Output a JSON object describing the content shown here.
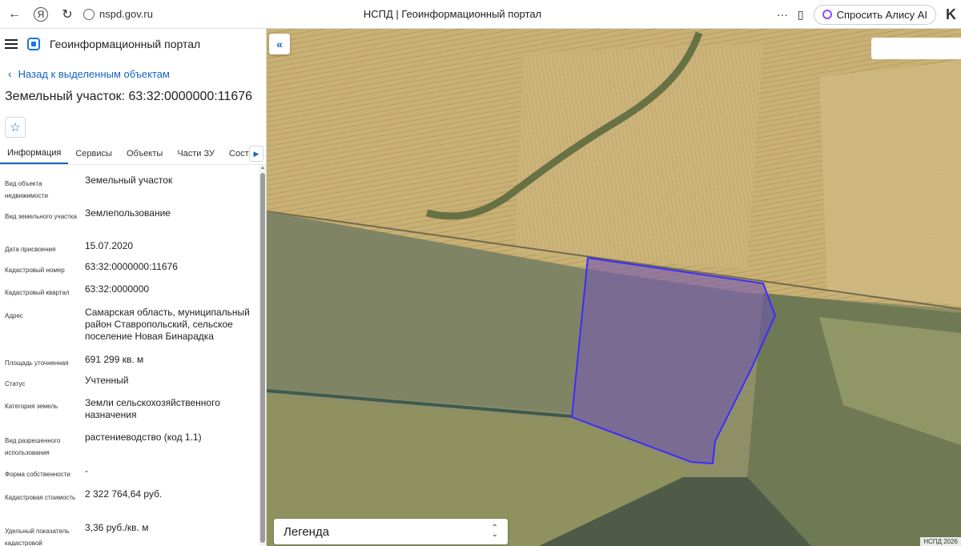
{
  "browser": {
    "url": "nspd.gov.ru",
    "tab_title": "НСПД | Геоинформационный портал",
    "alice_label": "Спросить Алису AI"
  },
  "panel": {
    "portal_title": "Геоинформационный портал",
    "back_link": "Назад к выделенным объектам",
    "object_title": "Земельный участок: 63:32:0000000:11676",
    "tabs": [
      {
        "label": "Информация",
        "active": true
      },
      {
        "label": "Сервисы"
      },
      {
        "label": "Объекты"
      },
      {
        "label": "Части ЗУ"
      },
      {
        "label": "Состав"
      }
    ],
    "rows": [
      {
        "key": "Вид объекта недвижимости",
        "value": "Земельный участок"
      },
      {
        "key": "Вид земельного участка",
        "value": "Землепользование"
      },
      {
        "key": "Дата присвоения",
        "value": "15.07.2020"
      },
      {
        "key": "Кадастровый номер",
        "value": "63:32:0000000:11676"
      },
      {
        "key": "Кадастровый квартал",
        "value": "63:32:0000000"
      },
      {
        "key": "Адрес",
        "value": "Самарская область, муниципальный район Ставропольский, сельское поселение Новая Бинарадка"
      },
      {
        "key": "Площадь уточненная",
        "value": "691 299 кв. м"
      },
      {
        "key": "Статус",
        "value": "Учтенный"
      },
      {
        "key": "Категория земель",
        "value": "Земли сельскохозяйственного назначения"
      },
      {
        "key": "Вид разрешенного использования",
        "value": "растениеводство (код 1.1)"
      },
      {
        "key": "Форма собственности",
        "value": "-"
      },
      {
        "key": "Кадастровая стоимость",
        "value": "2 322 764,64 руб."
      },
      {
        "key": "Удельный показатель кадастровой",
        "value": "3,36 руб./кв. м"
      }
    ]
  },
  "map": {
    "legend_label": "Легенда",
    "copyright": "НСПД 2026",
    "parcel_color": "#6a4fb8",
    "parcel_outline": "#3b2cff"
  }
}
